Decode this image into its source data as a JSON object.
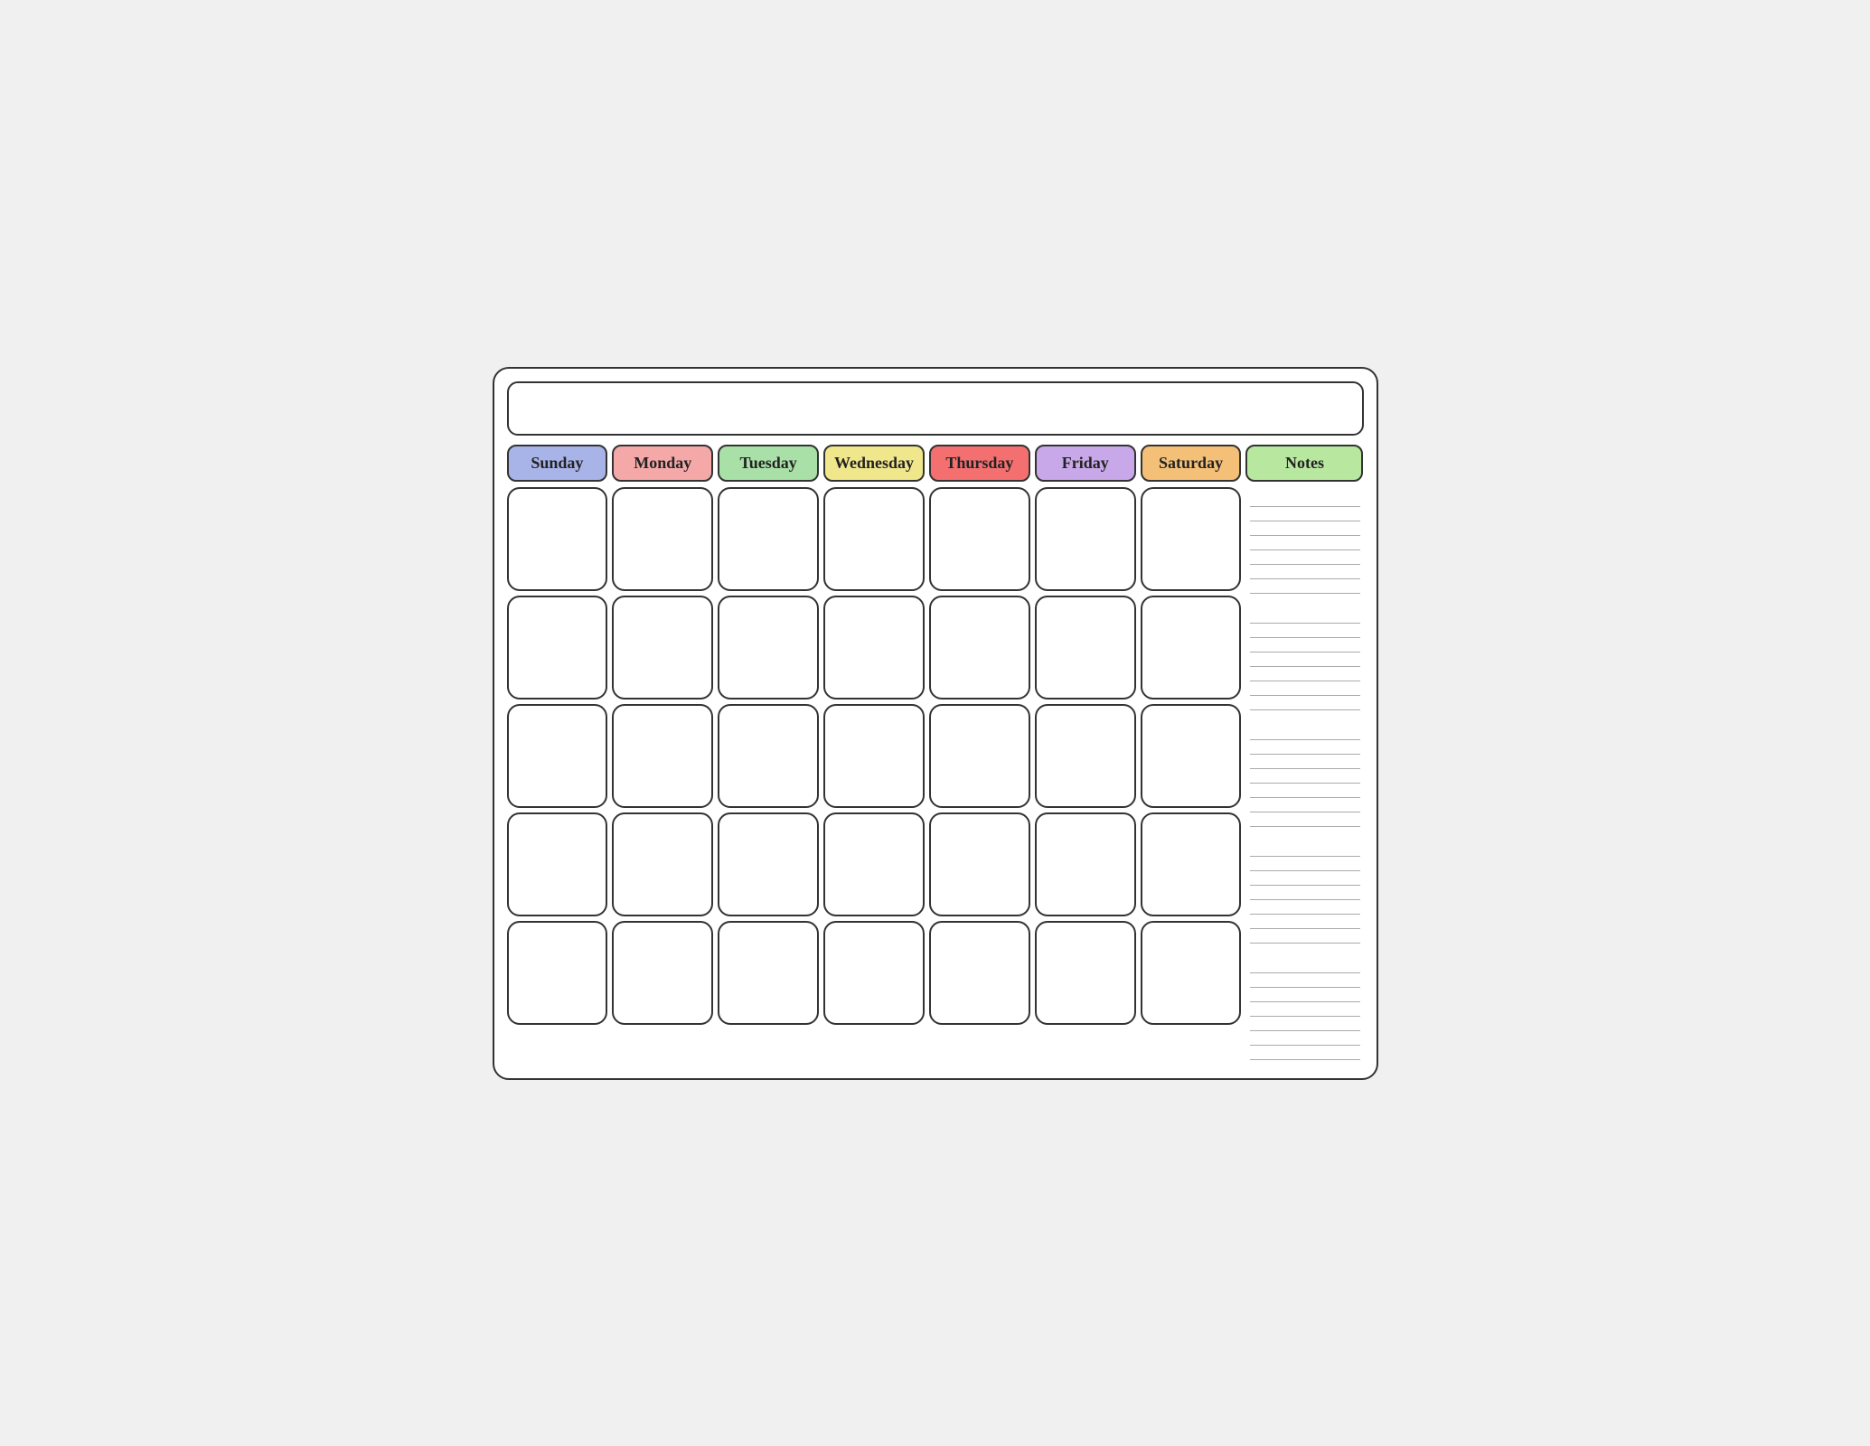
{
  "calendar": {
    "title": "",
    "headers": [
      {
        "id": "sunday",
        "label": "Sunday",
        "class": "header-sunday"
      },
      {
        "id": "monday",
        "label": "Monday",
        "class": "header-monday"
      },
      {
        "id": "tuesday",
        "label": "Tuesday",
        "class": "header-tuesday"
      },
      {
        "id": "wednesday",
        "label": "Wednesday",
        "class": "header-wednesday"
      },
      {
        "id": "thursday",
        "label": "Thursday",
        "class": "header-thursday"
      },
      {
        "id": "friday",
        "label": "Friday",
        "class": "header-friday"
      },
      {
        "id": "saturday",
        "label": "Saturday",
        "class": "header-saturday"
      },
      {
        "id": "notes",
        "label": "Notes",
        "class": "header-notes"
      }
    ],
    "weeks": 5,
    "days_per_week": 7,
    "notes_lines_per_row": 7
  }
}
